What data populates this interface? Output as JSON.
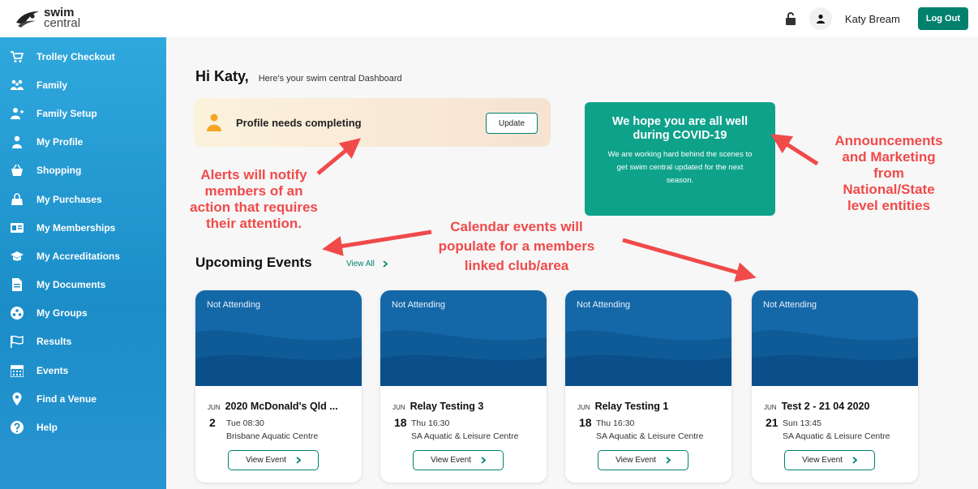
{
  "header": {
    "logo_line1": "swim",
    "logo_line2": "central",
    "user_name": "Katy Bream",
    "logout_label": "Log Out"
  },
  "sidebar": {
    "items": [
      {
        "label": "Trolley Checkout",
        "icon": "cart-icon"
      },
      {
        "label": "Family",
        "icon": "family-icon"
      },
      {
        "label": "Family Setup",
        "icon": "add-user-icon"
      },
      {
        "label": "My Profile",
        "icon": "user-icon"
      },
      {
        "label": "Shopping",
        "icon": "basket-icon"
      },
      {
        "label": "My Purchases",
        "icon": "shopping-bag-icon"
      },
      {
        "label": "My Memberships",
        "icon": "id-card-icon"
      },
      {
        "label": "My Accreditations",
        "icon": "graduation-cap-icon"
      },
      {
        "label": "My Documents",
        "icon": "document-icon"
      },
      {
        "label": "My Groups",
        "icon": "groups-icon"
      },
      {
        "label": "Results",
        "icon": "flag-icon"
      },
      {
        "label": "Events",
        "icon": "calendar-icon"
      },
      {
        "label": "Find a Venue",
        "icon": "location-pin-icon"
      },
      {
        "label": "Help",
        "icon": "question-icon"
      }
    ]
  },
  "main": {
    "greeting": "Hi Katy,",
    "subtitle": "Here's your swim central Dashboard",
    "alert": {
      "text": "Profile needs completing",
      "button_label": "Update"
    },
    "announcement": {
      "title": "We hope you are all well during COVID-19",
      "body": "We are working hard behind the scenes to get swim central updated for the next season."
    },
    "events_title": "Upcoming Events",
    "view_all_label": "View All",
    "events": [
      {
        "status": "Not Attending",
        "month": "JUN",
        "name": "2020 McDonald's Qld ...",
        "day": "2",
        "time": "Tue 08:30",
        "venue": "Brisbane Aquatic Centre",
        "button_label": "View Event"
      },
      {
        "status": "Not Attending",
        "month": "JUN",
        "name": "Relay Testing 3",
        "day": "18",
        "time": "Thu 16:30",
        "venue": "SA Aquatic & Leisure Centre",
        "button_label": "View Event"
      },
      {
        "status": "Not Attending",
        "month": "JUN",
        "name": "Relay Testing 1",
        "day": "18",
        "time": "Thu 16:30",
        "venue": "SA Aquatic & Leisure Centre",
        "button_label": "View Event"
      },
      {
        "status": "Not Attending",
        "month": "JUN",
        "name": "Test 2 - 21 04 2020",
        "day": "21",
        "time": "Sun 13:45",
        "venue": "SA Aquatic & Leisure Centre",
        "button_label": "View Event"
      }
    ]
  },
  "annotations": {
    "alerts": [
      "Alerts will notify",
      "members of an",
      "action that requires",
      "their attention."
    ],
    "calendar": [
      "Calendar events will",
      "populate for a members",
      "linked club/area"
    ],
    "announcements": [
      "Announcements",
      "and Marketing",
      "from",
      "National/State",
      "level entities"
    ]
  },
  "colors": {
    "accent": "#00816e",
    "sidebar": "#1b8dc8",
    "announcement_bg": "#0fa28b",
    "event_banner": "#1568a8",
    "annotation": "#f04a4a"
  }
}
